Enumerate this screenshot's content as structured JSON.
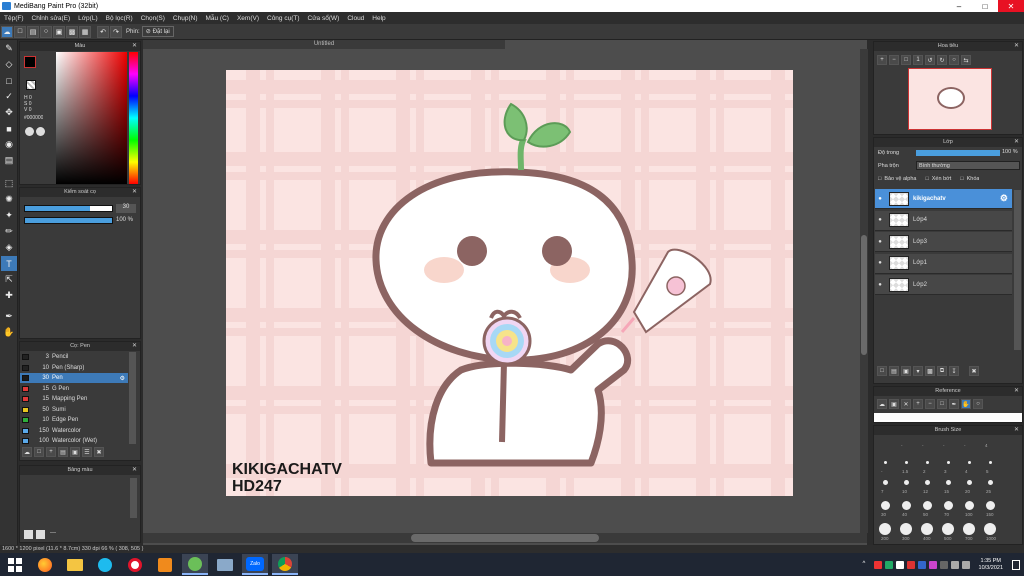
{
  "window": {
    "title": "MediBang Paint Pro (32bit)"
  },
  "menu": [
    "Tệp(F)",
    "Chỉnh sửa(E)",
    "Lớp(L)",
    "Bộ lọc(R)",
    "Chọn(S)",
    "Chụp(N)",
    "Mẫu (C)",
    "Xem(V)",
    "Công cụ(T)",
    "Cửa sổ(W)",
    "Cloud",
    "Help"
  ],
  "toolbar": {
    "pen_label": "Phin:",
    "antialias_label": "Đặt lại"
  },
  "document": {
    "tab_title": "Untitled"
  },
  "color_panel": {
    "title": "Màu",
    "h": "H 0",
    "s": "S 0",
    "v": "V 0",
    "hex": "#000000"
  },
  "brush_control": {
    "title": "Kiểm soát cọ",
    "size_value": "30",
    "opacity_value": "100 %",
    "size_fill": 0.75,
    "opacity_fill": 1.0
  },
  "brush_panel": {
    "title": "Cọ: Pen",
    "items": [
      {
        "size": "3",
        "name": "Pencil",
        "color": "#222222"
      },
      {
        "size": "10",
        "name": "Pen (Sharp)",
        "color": "#222222"
      },
      {
        "size": "30",
        "name": "Pen",
        "color": "#1a1a1a"
      },
      {
        "size": "15",
        "name": "G Pen",
        "color": "#e03a3a"
      },
      {
        "size": "15",
        "name": "Mapping Pen",
        "color": "#e03a3a"
      },
      {
        "size": "50",
        "name": "Sumi",
        "color": "#e8c61f"
      },
      {
        "size": "10",
        "name": "Edge Pen",
        "color": "#2eae3a"
      },
      {
        "size": "150",
        "name": "Watercolor",
        "color": "#5aa8e8"
      },
      {
        "size": "100",
        "name": "Watercolor (Wet)",
        "color": "#5aa8e8"
      }
    ]
  },
  "color_swatch_panel": {
    "title": "Bảng màu",
    "placeholder": "---"
  },
  "navigator": {
    "title": "Hoa tiêu"
  },
  "layers_panel": {
    "title": "Lớp",
    "opacity_label": "Độ trong",
    "opacity_value": "100 %",
    "blend_label": "Pha trộn",
    "blend_value": "Bình thường",
    "protect_alpha": "Bảo vệ alpha",
    "clipping": "Xén bớt",
    "lock": "Khóa",
    "layers": [
      "kikigachatv",
      "Lớp4",
      "Lớp3",
      "Lớp1",
      "Lớp2"
    ]
  },
  "reference_panel": {
    "title": "Reference"
  },
  "brush_size_panel": {
    "title": "Brush Size",
    "sizes": [
      "-",
      "-",
      "-",
      "-",
      "4",
      "-",
      "1.5",
      "2",
      "3",
      "4",
      "5",
      "7",
      "10",
      "12",
      "15",
      "20",
      "25",
      "30",
      "40",
      "50",
      "70",
      "100",
      "150",
      "200",
      "300",
      "400",
      "500",
      "700",
      "1000"
    ]
  },
  "artwork": {
    "watermark_line1": "KIKIGACHATV",
    "watermark_line2": "HD247"
  },
  "status": "1600 * 1200 pixel  (11.6 * 8.7cm)  330 dpi  66 %  ( 308, 505 )",
  "taskbar": {
    "time": "1:35 PM",
    "date": "10/3/2021",
    "zalo": "Zalo"
  }
}
